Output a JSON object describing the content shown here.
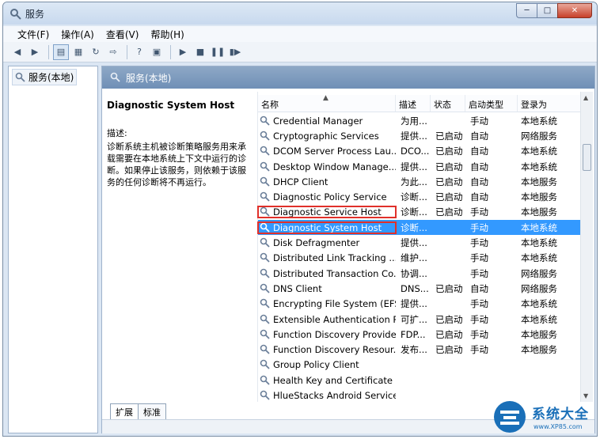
{
  "window": {
    "title": "服务"
  },
  "window_buttons": {
    "minimize": "─",
    "maximize": "□",
    "close": "✕"
  },
  "menu": [
    "文件(F)",
    "操作(A)",
    "查看(V)",
    "帮助(H)"
  ],
  "tree": {
    "root_label": "服务(本地)"
  },
  "panel": {
    "header": "服务(本地)"
  },
  "detail": {
    "title": "Diagnostic System Host",
    "label": "描述:",
    "text": "诊断系统主机被诊断策略服务用来承载需要在本地系统上下文中运行的诊断。如果停止该服务，则依赖于该服务的任何诊断将不再运行。"
  },
  "columns": {
    "name": "名称",
    "desc": "描述",
    "status": "状态",
    "startup": "启动类型",
    "logon": "登录为"
  },
  "services": [
    {
      "name": "Credential Manager",
      "desc": "为用...",
      "status": "",
      "startup": "手动",
      "logon": "本地系统"
    },
    {
      "name": "Cryptographic Services",
      "desc": "提供...",
      "status": "已启动",
      "startup": "自动",
      "logon": "网络服务"
    },
    {
      "name": "DCOM Server Process Lau...",
      "desc": "DCO...",
      "status": "已启动",
      "startup": "自动",
      "logon": "本地系统"
    },
    {
      "name": "Desktop Window Manage...",
      "desc": "提供...",
      "status": "已启动",
      "startup": "自动",
      "logon": "本地系统"
    },
    {
      "name": "DHCP Client",
      "desc": "为此...",
      "status": "已启动",
      "startup": "自动",
      "logon": "本地服务"
    },
    {
      "name": "Diagnostic Policy Service",
      "desc": "诊断...",
      "status": "已启动",
      "startup": "自动",
      "logon": "本地服务"
    },
    {
      "name": "Diagnostic Service Host",
      "desc": "诊断...",
      "status": "已启动",
      "startup": "手动",
      "logon": "本地服务"
    },
    {
      "name": "Diagnostic System Host",
      "desc": "诊断...",
      "status": "",
      "startup": "手动",
      "logon": "本地系统"
    },
    {
      "name": "Disk Defragmenter",
      "desc": "提供...",
      "status": "",
      "startup": "手动",
      "logon": "本地系统"
    },
    {
      "name": "Distributed Link Tracking ...",
      "desc": "维护...",
      "status": "",
      "startup": "手动",
      "logon": "本地系统"
    },
    {
      "name": "Distributed Transaction Co...",
      "desc": "协调...",
      "status": "",
      "startup": "手动",
      "logon": "网络服务"
    },
    {
      "name": "DNS Client",
      "desc": "DNS...",
      "status": "已启动",
      "startup": "自动",
      "logon": "网络服务"
    },
    {
      "name": "Encrypting File System (EFS)",
      "desc": "提供...",
      "status": "",
      "startup": "手动",
      "logon": "本地系统"
    },
    {
      "name": "Extensible Authentication P...",
      "desc": "可扩...",
      "status": "已启动",
      "startup": "手动",
      "logon": "本地系统"
    },
    {
      "name": "Function Discovery Provide...",
      "desc": "FDP...",
      "status": "已启动",
      "startup": "手动",
      "logon": "本地服务"
    },
    {
      "name": "Function Discovery Resour...",
      "desc": "发布...",
      "status": "已启动",
      "startup": "手动",
      "logon": "本地服务"
    },
    {
      "name": "Group Policy Client",
      "desc": "",
      "status": "",
      "startup": "",
      "logon": ""
    },
    {
      "name": "Health Key and Certificate ...",
      "desc": "",
      "status": "",
      "startup": "",
      "logon": ""
    },
    {
      "name": "HlueStacks Android Service",
      "desc": "",
      "status": "",
      "startup": "",
      "logon": ""
    }
  ],
  "tabs": [
    "扩展",
    "标准"
  ],
  "watermark": {
    "text": "系统大全",
    "url": "www.XP85.com"
  },
  "colors": {
    "selection": "#3399ff",
    "highlight_box": "#e0302a",
    "panel_header": "#7f9bbf"
  }
}
